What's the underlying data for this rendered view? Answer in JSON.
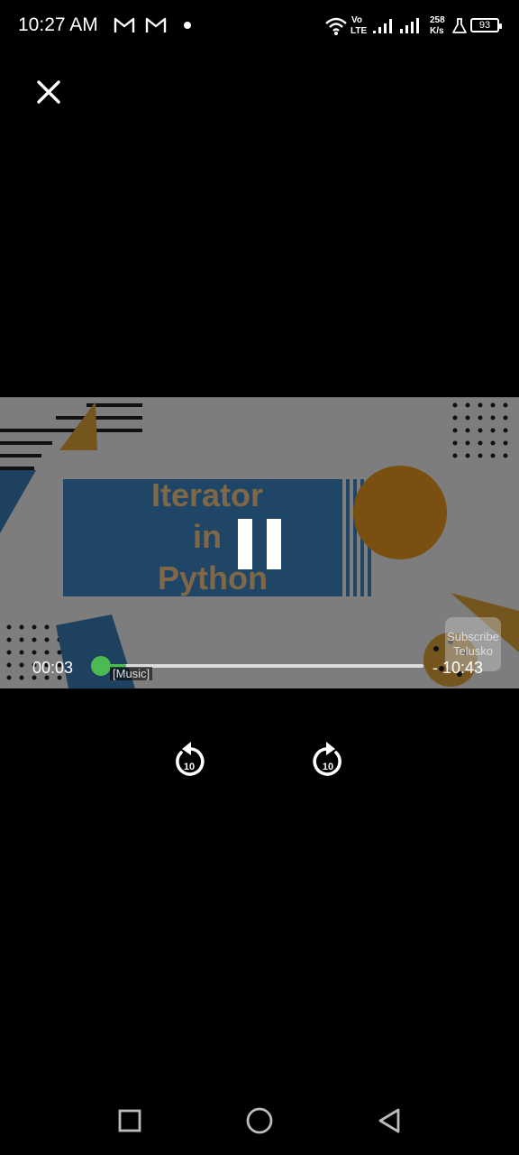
{
  "status_bar": {
    "time": "10:27 AM",
    "network_top": "Vo",
    "network_bottom": "LTE",
    "speed_value": "258",
    "speed_unit": "K/s",
    "battery": "93",
    "icons": [
      "gmail-icon",
      "gmail-icon",
      "notification-dot",
      "wifi-icon",
      "signal-icon",
      "signal-icon",
      "lab-flask-icon",
      "battery-icon"
    ]
  },
  "player": {
    "close_icon": "close-icon",
    "video_title_lines": [
      "Iterator",
      "in",
      "Python"
    ],
    "play_state_icon": "pause-icon",
    "current_time": "00:03",
    "remaining_time": "- 10:43",
    "progress_fraction": 0.005,
    "caption": "[Music]",
    "watermark": {
      "line1": "Subscribe",
      "line2": "Telusko"
    },
    "rewind_label": "10",
    "forward_label": "10",
    "accent_color": "#4cba52"
  },
  "nav_bar": {
    "buttons": [
      "recents-square-icon",
      "home-circle-icon",
      "back-triangle-icon"
    ]
  }
}
